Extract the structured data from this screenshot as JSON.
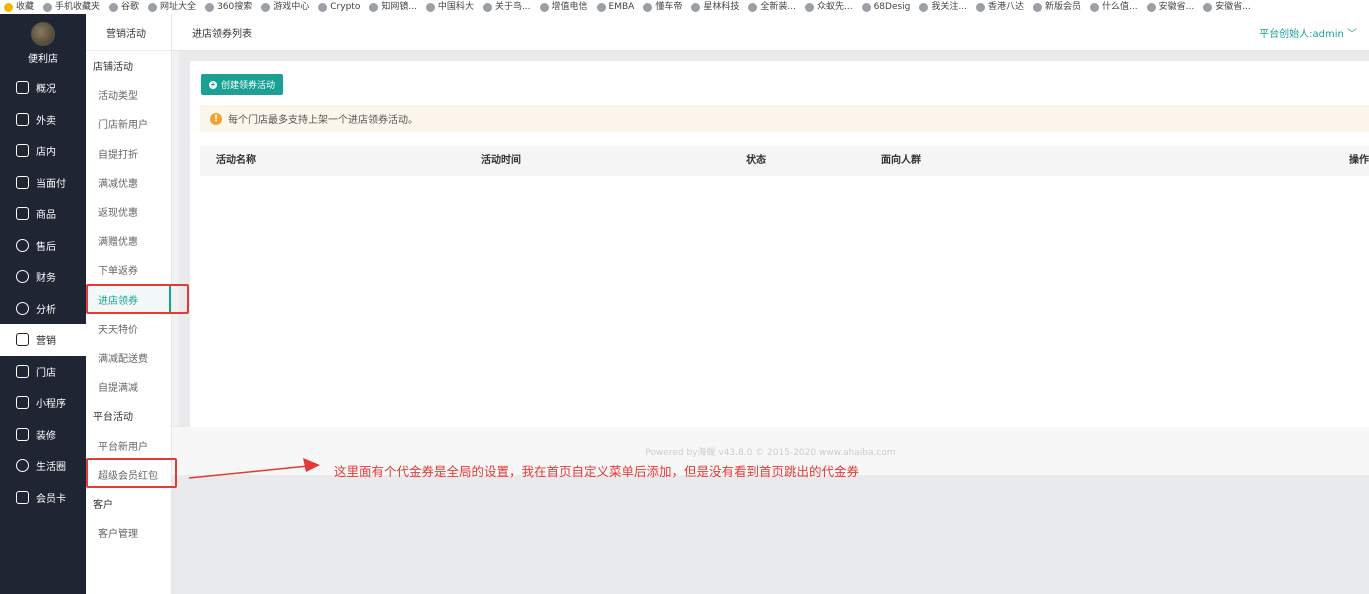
{
  "bookmarks": [
    {
      "label": "收藏",
      "icon": "star-icon"
    },
    {
      "label": "手机收藏夹",
      "icon": "phone-icon"
    },
    {
      "label": "谷歌",
      "icon": "globe-icon"
    },
    {
      "label": "网址大全",
      "icon": "globe-icon"
    },
    {
      "label": "360搜索",
      "icon": "search-icon"
    },
    {
      "label": "游戏中心",
      "icon": "game-icon"
    },
    {
      "label": "Crypto",
      "icon": "globe-icon"
    },
    {
      "label": "知网镜...",
      "icon": "globe-icon"
    },
    {
      "label": "中国科大",
      "icon": "globe-icon"
    },
    {
      "label": "关于鸟...",
      "icon": "globe-icon"
    },
    {
      "label": "增值电信",
      "icon": "globe-icon"
    },
    {
      "label": "EMBA",
      "icon": "globe-icon"
    },
    {
      "label": "懂车帝",
      "icon": "car-icon"
    },
    {
      "label": "星林科技",
      "icon": "diamond-icon"
    },
    {
      "label": "全新装...",
      "icon": "globe-icon"
    },
    {
      "label": "众蚁先...",
      "icon": "globe-icon"
    },
    {
      "label": "68Desig",
      "icon": "globe-icon"
    },
    {
      "label": "我关注...",
      "icon": "globe-icon"
    },
    {
      "label": "香港八达",
      "icon": "globe-icon"
    },
    {
      "label": "新版会员",
      "icon": "globe-icon"
    },
    {
      "label": "什么值...",
      "icon": "globe-icon"
    },
    {
      "label": "安徽省...",
      "icon": "globe-icon"
    },
    {
      "label": "安徽省...",
      "icon": "globe-icon"
    }
  ],
  "brand": {
    "name": "便利店"
  },
  "main_nav": [
    {
      "label": "概况",
      "icon": "overview-icon",
      "active": false
    },
    {
      "label": "外卖",
      "icon": "takeout-icon",
      "active": false
    },
    {
      "label": "店内",
      "icon": "store-icon",
      "active": false
    },
    {
      "label": "当面付",
      "icon": "pay-icon",
      "active": false
    },
    {
      "label": "商品",
      "icon": "goods-icon",
      "active": false
    },
    {
      "label": "售后",
      "icon": "aftersale-icon",
      "active": false
    },
    {
      "label": "财务",
      "icon": "finance-icon",
      "active": false
    },
    {
      "label": "分析",
      "icon": "analysis-icon",
      "active": false
    },
    {
      "label": "营销",
      "icon": "marketing-icon",
      "active": true
    },
    {
      "label": "门店",
      "icon": "shop-icon",
      "active": false
    },
    {
      "label": "小程序",
      "icon": "miniapp-icon",
      "active": false
    },
    {
      "label": "装修",
      "icon": "decorate-icon",
      "active": false
    },
    {
      "label": "生活圈",
      "icon": "globe-icon",
      "active": false
    },
    {
      "label": "会员卡",
      "icon": "card-icon",
      "active": false
    }
  ],
  "sub_nav": {
    "header": "营销活动",
    "items": [
      {
        "label": "店铺活动",
        "type": "group"
      },
      {
        "label": "活动类型",
        "type": "item"
      },
      {
        "label": "门店新用户",
        "type": "item"
      },
      {
        "label": "自提打折",
        "type": "item"
      },
      {
        "label": "满减优惠",
        "type": "item"
      },
      {
        "label": "返现优惠",
        "type": "item"
      },
      {
        "label": "满赠优惠",
        "type": "item"
      },
      {
        "label": "下单返券",
        "type": "item"
      },
      {
        "label": "进店领券",
        "type": "selected"
      },
      {
        "label": "天天特价",
        "type": "item"
      },
      {
        "label": "满减配送费",
        "type": "item"
      },
      {
        "label": "自提满减",
        "type": "item"
      },
      {
        "label": "平台活动",
        "type": "group"
      },
      {
        "label": "平台新用户",
        "type": "item"
      },
      {
        "label": "超级会员红包",
        "type": "item"
      },
      {
        "label": "客户",
        "type": "group"
      },
      {
        "label": "客户管理",
        "type": "item"
      }
    ]
  },
  "header": {
    "title": "进店领券列表",
    "user": "平台创始人:admin ﹀"
  },
  "toolbar": {
    "create_label": "创建领券活动"
  },
  "notice": {
    "text": "每个门店最多支持上架一个进店领券活动。"
  },
  "table": {
    "columns": [
      "活动名称",
      "活动时间",
      "状态",
      "面向人群",
      "操作"
    ],
    "rows": []
  },
  "footer": {
    "text": "Powered by海鲅 v43.8.0 © 2015-2020 www.ahaiba.com"
  },
  "annotation": {
    "text": "这里面有个代金券是全局的设置，我在首页自定义菜单后添加，但是没有看到首页跳出的代金券",
    "color": "#e53935"
  },
  "colors": {
    "accent": "#1aa094",
    "sidebar": "#202533",
    "notice_bg": "#fdf6ec",
    "warning": "#f0a330"
  }
}
